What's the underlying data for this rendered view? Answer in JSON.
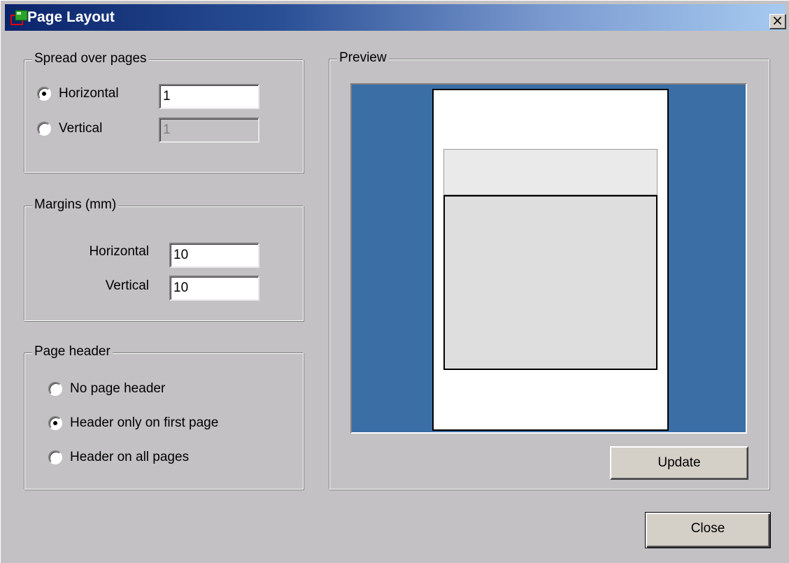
{
  "window": {
    "title": "Page Layout",
    "close_glyph": "×",
    "icon": "page-layout-app-icon"
  },
  "spread": {
    "legend": "Spread over pages",
    "horizontal_label": "Horizontal",
    "vertical_label": "Vertical",
    "horizontal_value": "1",
    "vertical_value": "1",
    "selected": "horizontal"
  },
  "margins": {
    "legend": "Margins (mm)",
    "horizontal_label": "Horizontal",
    "vertical_label": "Vertical",
    "horizontal_value": "10",
    "vertical_value": "10"
  },
  "header": {
    "legend": "Page header",
    "options": [
      "No page header",
      "Header only on first page",
      "Header on all pages"
    ],
    "selected_index": 1
  },
  "preview": {
    "legend": "Preview",
    "background_color": "#3a6ea5",
    "update_label": "Update"
  },
  "footer": {
    "close_label": "Close"
  }
}
